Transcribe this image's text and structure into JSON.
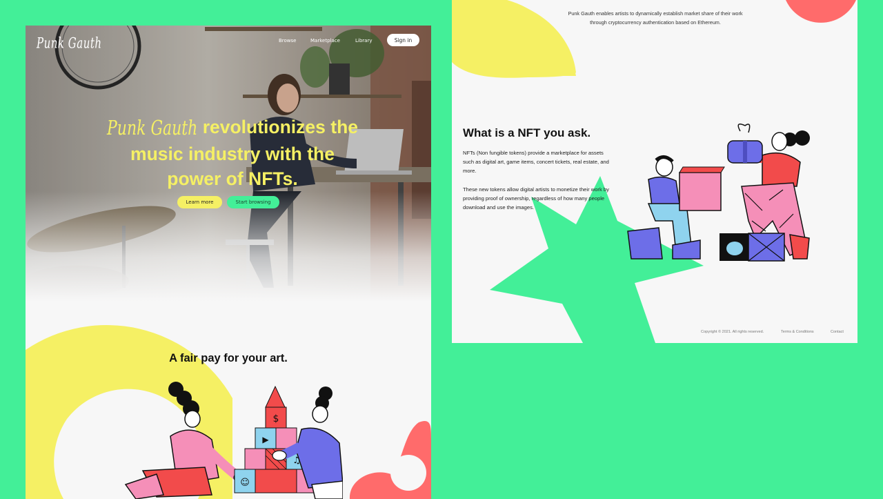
{
  "colors": {
    "background_green": "#43ef98",
    "accent_yellow": "#f5f064",
    "accent_coral": "#ff6b6b",
    "panel_bg": "#f7f7f7",
    "illustration_pink": "#f58fb8",
    "illustration_blue": "#6d6ee8",
    "illustration_red": "#f24b4b"
  },
  "left_page": {
    "logo": "Punk Gauth",
    "nav": {
      "browse": "Browse",
      "marketplace": "Marketplace",
      "library": "Library",
      "sign_in": "Sign in"
    },
    "hero": {
      "brand": "Punk Gauth",
      "headline_line1": "revolutionizes the",
      "headline_line2": "music industry with the",
      "headline_line3": "power of NFTs.",
      "learn_more": "Learn more",
      "start_browsing": "Start browsing"
    },
    "fair_pay_title": "A fair pay for your art.",
    "illustration": {
      "block_symbols": [
        "$",
        "▶",
        "♫",
        "☺"
      ]
    }
  },
  "right_page": {
    "intro": "Punk Gauth enables artists to dynamically establish market share of their work through cryptocurrency authentication based on Ethereum.",
    "nft_title": "What is a NFT you ask.",
    "nft_paragraph_1": "NFTs (Non fungible tokens) provide a marketplace for assets such as digital art, game items, concert tickets, real estate, and more.",
    "nft_paragraph_2": "These new tokens allow digital artists to monetize their work by providing proof of ownership, regardless of how many people download and use the images.",
    "footer": {
      "copyright": "Copyright © 2021. All rights reserved.",
      "terms": "Terms & Conditions",
      "contact": "Contact"
    }
  }
}
